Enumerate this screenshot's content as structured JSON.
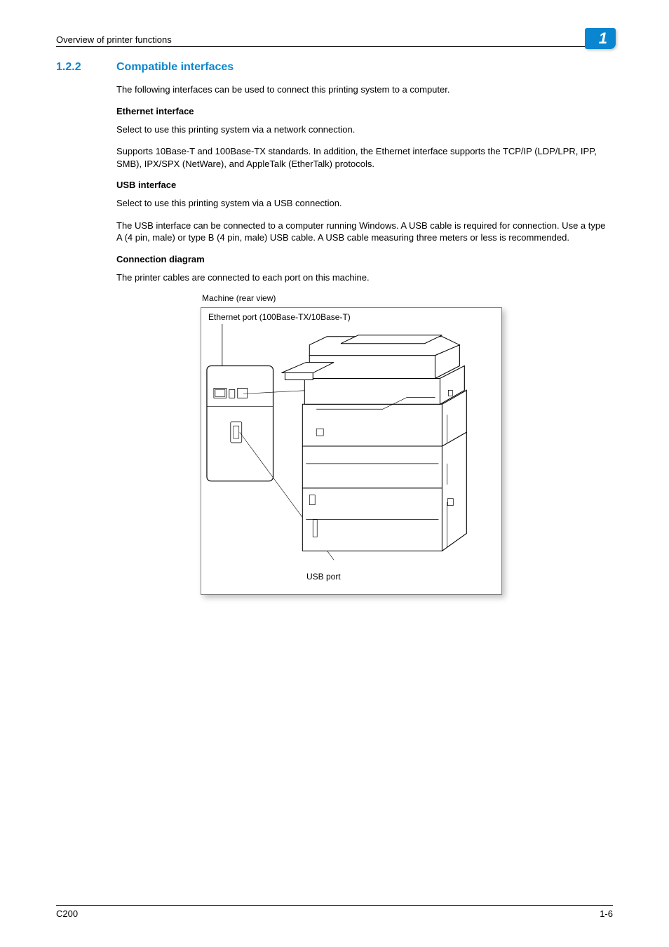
{
  "header": {
    "running_head": "Overview of printer functions",
    "chapter_number": "1"
  },
  "section": {
    "number": "1.2.2",
    "title": "Compatible interfaces",
    "intro": "The following interfaces can be used to connect this printing system to a computer."
  },
  "ethernet": {
    "heading": "Ethernet interface",
    "p1": "Select to use this printing system via a network connection.",
    "p2": "Supports 10Base-T and 100Base-TX standards. In addition, the Ethernet interface supports the TCP/IP (LDP/LPR, IPP, SMB), IPX/SPX (NetWare), and AppleTalk (EtherTalk) protocols."
  },
  "usb": {
    "heading": "USB interface",
    "p1": "Select to use this printing system via a USB connection.",
    "p2": "The USB interface can be connected to a computer running Windows. A USB cable is required for connection. Use a type A (4 pin, male) or type B (4 pin, male) USB cable. A USB cable measuring three meters or less is recommended."
  },
  "diagram": {
    "heading": "Connection diagram",
    "intro": "The printer cables are connected to each port on this machine.",
    "caption": "Machine (rear view)",
    "ethernet_label": "Ethernet port (100Base-TX/10Base-T)",
    "usb_label": "USB port"
  },
  "footer": {
    "model": "C200",
    "page": "1-6"
  }
}
